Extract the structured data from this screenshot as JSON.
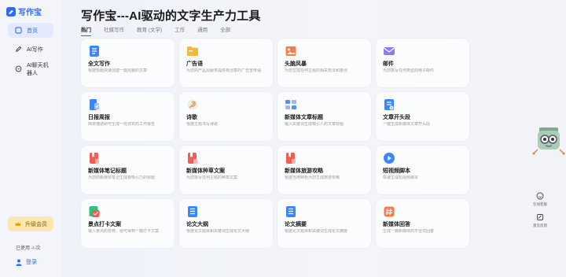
{
  "app": {
    "logo_text": "写作宝",
    "title": "写作宝---AI驱动的文字生产力工具"
  },
  "sidebar": {
    "items": [
      {
        "label": "首页",
        "icon": "home-icon",
        "active": true
      },
      {
        "label": "AI写作",
        "icon": "pen-icon",
        "active": false
      },
      {
        "label": "AI聊天机器人",
        "icon": "chat-icon",
        "active": false
      }
    ],
    "upgrade_label": "升级会员",
    "usage_text": "已使用 -/-次",
    "login_label": "登录"
  },
  "tabs": [
    {
      "label": "热门",
      "active": true
    },
    {
      "label": "社媒写作",
      "active": false
    },
    {
      "label": "教育 (文学)",
      "active": false
    },
    {
      "label": "工作",
      "active": false
    },
    {
      "label": "通用",
      "active": false
    },
    {
      "label": "全部",
      "active": false
    }
  ],
  "cards": [
    {
      "title": "全文写作",
      "desc": "根据标题快速创建一篇完整的文章",
      "icon": "document-icon",
      "color": "#3a86ff"
    },
    {
      "title": "广告语",
      "desc": "为您的产品及服务提供有创意的广告宣传语",
      "icon": "folder-icon",
      "color": "#f4b73b"
    },
    {
      "title": "头脑风暴",
      "desc": "为您生成任何主题的相关想法和要点",
      "icon": "image-icon",
      "color": "#ff7a45"
    },
    {
      "title": "邮件",
      "desc": "为您撰写任何类型的电子邮件",
      "icon": "mail-icon",
      "color": "#8b7cf6"
    },
    {
      "title": "日报周报",
      "desc": "简单描述即可生成一份详实的工作报告",
      "icon": "report-icon",
      "color": "#3a86ff"
    },
    {
      "title": "诗歌",
      "desc": "根据主题书写诗歌",
      "icon": "feather-icon",
      "color": "#c9a36b"
    },
    {
      "title": "新媒体文章标题",
      "desc": "输入关键词生成吸引人的文章标题",
      "icon": "title-icon",
      "color": "#5b8def"
    },
    {
      "title": "文章开头段",
      "desc": "一键生成新媒体文章开头段",
      "icon": "paragraph-icon",
      "color": "#3a86ff"
    },
    {
      "title": "新媒体笔记标题",
      "desc": "为您的新媒体笔记生成有吸引力的标题",
      "icon": "note-icon",
      "color": "#f25c54"
    },
    {
      "title": "新媒体种草文案",
      "desc": "为您撰写任何主题的种草文案",
      "icon": "note-icon",
      "color": "#f25c54"
    },
    {
      "title": "新媒体旅游攻略",
      "desc": "根据当地特色为您生成旅游攻略",
      "icon": "note-icon",
      "color": "#f25c54"
    },
    {
      "title": "短视频脚本",
      "desc": "快速生成短视频脚本",
      "icon": "video-icon",
      "color": "#3a86ff"
    },
    {
      "title": "景点打卡文案",
      "desc": "输入景点的名称，便可得到一篇打卡文案",
      "icon": "ticket-icon",
      "color": "#2ec27e"
    },
    {
      "title": "论文大纲",
      "desc": "根据论文题目和关键词生成论文大纲",
      "icon": "doc-outline-icon",
      "color": "#3a86ff"
    },
    {
      "title": "论文摘要",
      "desc": "根据论文题目和关键词生成论文摘要",
      "icon": "doc-outline-icon",
      "color": "#3a86ff"
    },
    {
      "title": "新媒体回答",
      "desc": "生成一篇新媒体的平台式回答",
      "icon": "hash-icon",
      "color": "#ff7a45"
    }
  ],
  "right_tools": [
    {
      "label": "在线客服",
      "icon": "service-icon"
    },
    {
      "label": "意见反馈",
      "icon": "feedback-icon"
    }
  ]
}
